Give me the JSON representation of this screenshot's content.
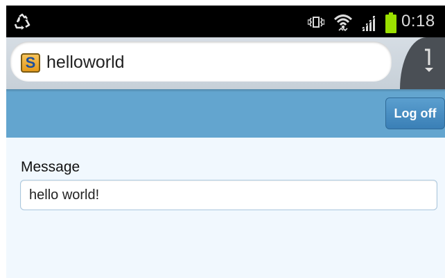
{
  "status_bar": {
    "time": "0:18",
    "icons": [
      "recycle-icon",
      "vibrate-icon",
      "wifi-icon",
      "signal-icon",
      "battery-icon"
    ],
    "battery_color": "#9be000"
  },
  "address_bar": {
    "url": "helloworld",
    "favicon_letter": "S",
    "menu_icon": "menu-icon"
  },
  "header": {
    "background": "#63a5cf",
    "logoff_label": "Log off"
  },
  "form": {
    "message_label": "Message",
    "message_value": "hello world!"
  }
}
